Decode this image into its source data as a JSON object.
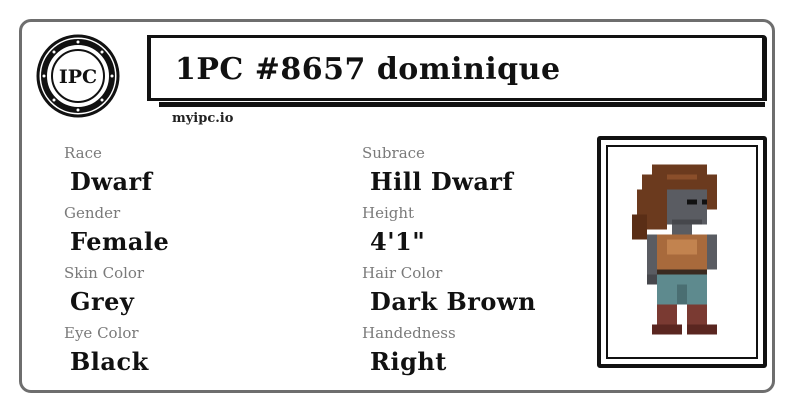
{
  "logo": {
    "text": "IPC"
  },
  "header": {
    "title": "1PC #8657 dominique",
    "site": "myipc.io"
  },
  "fields": [
    {
      "label": "Race",
      "value": "Dwarf"
    },
    {
      "label": "Subrace",
      "value": "Hill Dwarf"
    },
    {
      "label": "Gender",
      "value": "Female"
    },
    {
      "label": "Height",
      "value": "4'1\""
    },
    {
      "label": "Skin Color",
      "value": "Grey"
    },
    {
      "label": "Hair Color",
      "value": "Dark Brown"
    },
    {
      "label": "Eye Color",
      "value": "Black"
    },
    {
      "label": "Handedness",
      "value": "Right"
    }
  ],
  "colors": {
    "border": "#6e6e6e",
    "label": "#7a7a7a",
    "text": "#111111",
    "hair": "#6b3a1e",
    "skin": "#5a5c62",
    "shirt": "#a86a3c",
    "pants": "#5e8a8e",
    "boots": "#7a3a32"
  },
  "portrait": {
    "icon": "character-sprite-icon"
  }
}
